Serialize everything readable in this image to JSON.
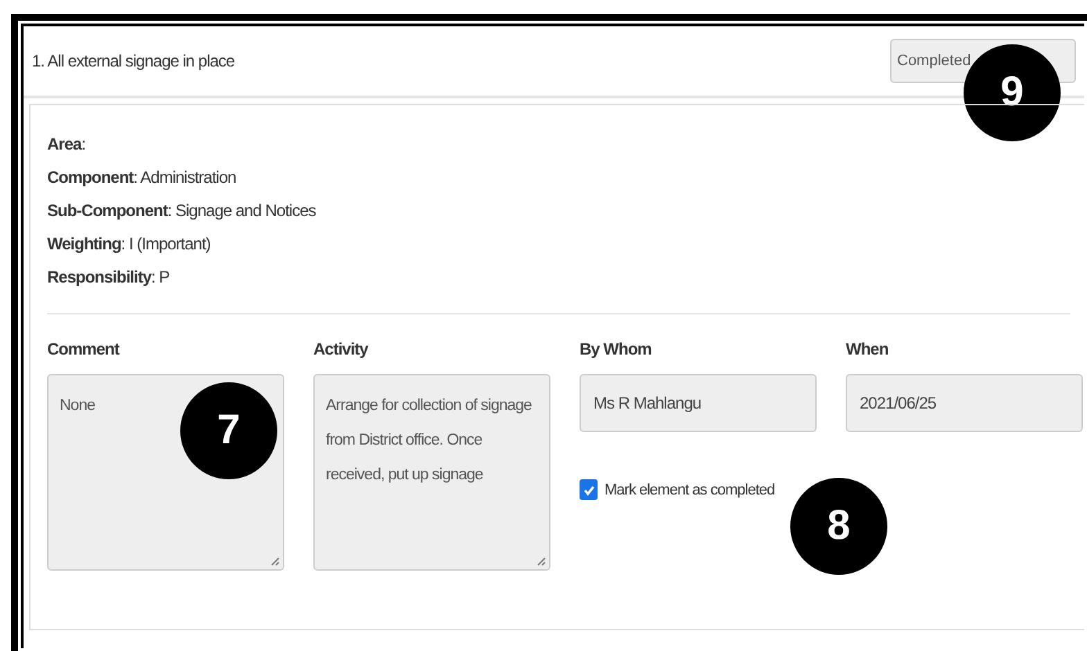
{
  "header": {
    "title": "1. All external signage in place",
    "status_button": "Completed"
  },
  "details": [
    "**Area**:",
    "**Component**: Administration",
    "**Sub-Component**: Signage and Notices",
    "**Weighting**: I (Important)",
    "**Responsibility**: P"
  ],
  "fields": [
    {
      "label": "Comment",
      "kind": "textarea",
      "value": "None"
    },
    {
      "label": "Activity",
      "kind": "textarea",
      "value": "Arrange for collection of signage from District office. Once received, put up signage"
    },
    {
      "label": "By Whom",
      "kind": "input",
      "value": "Ms R Mahlangu"
    },
    {
      "label": "When",
      "kind": "input",
      "value": "2021/06/25"
    }
  ],
  "mark_complete": {
    "label": "Mark element as completed",
    "checked": true
  },
  "callouts": [
    {
      "number": "9"
    },
    {
      "number": "7"
    },
    {
      "number": "8"
    }
  ]
}
